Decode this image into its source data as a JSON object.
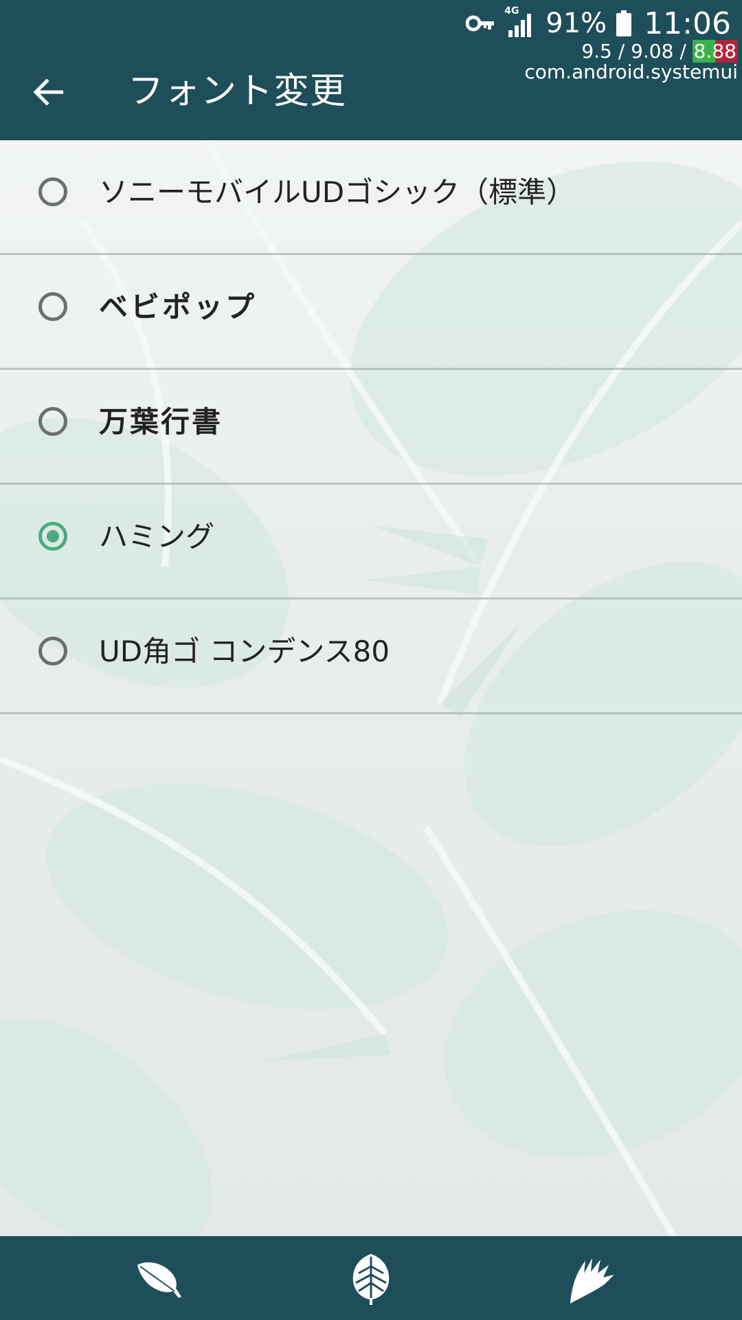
{
  "status_bar": {
    "network": "4G",
    "battery_percent": "91%",
    "time": "11:06",
    "icons": [
      "key-icon",
      "signal-icon",
      "battery-icon"
    ]
  },
  "debug_overlay": {
    "fps_prefix": "9.5 / 9.08 / ",
    "fps_highlight": "8.88",
    "package": "com.android.systemui"
  },
  "app_bar": {
    "title": "フォント変更",
    "back_icon": "back-arrow-icon"
  },
  "fonts": {
    "selected_index": 3,
    "items": [
      {
        "label": "ソニーモバイルUDゴシック（標準）"
      },
      {
        "label": "ベビポップ"
      },
      {
        "label": "万葉行書"
      },
      {
        "label": "ハミング"
      },
      {
        "label": "UD角ゴ コンデンス80"
      }
    ]
  },
  "bottom_nav": {
    "items": [
      "feather-leaf-icon",
      "monstera-leaf-icon",
      "palm-leaf-icon"
    ]
  },
  "colors": {
    "bar": "#1e4e5a",
    "accent": "#4caa82",
    "radio_off": "#6b6f6e"
  }
}
